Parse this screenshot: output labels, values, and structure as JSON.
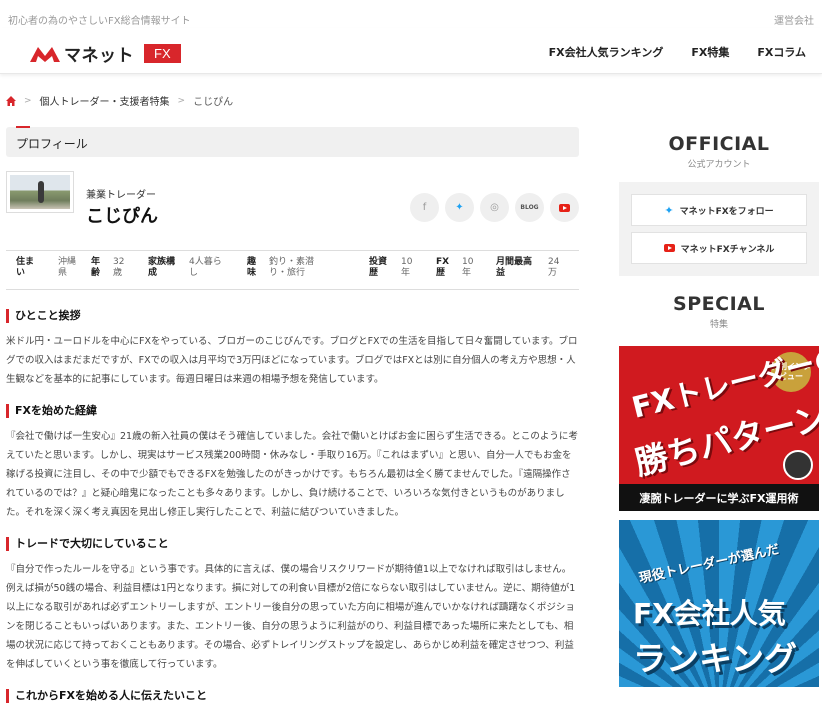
{
  "site": {
    "tagline": "初心者の為のやさしいFX総合情報サイト",
    "operator_link": "運営会社",
    "logo_text": "マネット",
    "logo_badge": "FX",
    "brand_color": "#d8262b"
  },
  "nav": [
    "FX会社人気ランキング",
    "FX特集",
    "FXコラム"
  ],
  "breadcrumb": {
    "home_icon": "home-icon",
    "items": [
      "個人トレーダー・支援者特集",
      "こじぴん"
    ]
  },
  "profile": {
    "section_title": "プロフィール",
    "role": "兼業トレーダー",
    "name": "こじぴん",
    "socials": [
      "facebook-icon",
      "twitter-icon",
      "instagram-icon",
      "BLOG",
      "youtube-icon"
    ],
    "stats": [
      {
        "label": "住まい",
        "value": "沖縄県"
      },
      {
        "label": "年齢",
        "value": "32歳"
      },
      {
        "label": "家族構成",
        "value": "4人暮らし"
      },
      {
        "label": "趣味",
        "value": "釣り・素潜り・旅行"
      },
      {
        "label": "投資歴",
        "value": "10年"
      },
      {
        "label": "FX歴",
        "value": "10年"
      },
      {
        "label": "月間最高益",
        "value": "24万"
      }
    ]
  },
  "sections": [
    {
      "title": "ひとこと挨拶",
      "body": "米ドル円・ユーロドルを中心にFXをやっている、ブロガーのこじぴんです。ブログとFXでの生活を目指して日々奮闘しています。ブログでの収入はまだまだですが、FXでの収入は月平均で3万円ほどになっています。ブログではFXとは別に自分個人の考え方や思想・人生観などを基本的に記事にしています。毎週日曜日は来週の相場予想を発信しています。"
    },
    {
      "title": "FXを始めた経緯",
      "body": "『会社で働けば一生安心』21歳の新入社員の僕はそう確信していました。会社で働いとけばお金に困らず生活できる。とこのように考えていたと思います。しかし、現実はサービス残業200時間・休みなし・手取り16万。『これはまずい』と思い、自分一人でもお金を稼げる投資に注目し、その中で少額でもできるFXを勉強したのがきっかけです。もちろん最初は全く勝てませんでした。『遠隔操作されているのでは？』と疑心暗鬼になったことも多々あります。しかし、負け続けることで、いろいろな気付きというものがありました。それを深く深く考え真因を見出し修正し実行したことで、利益に結びついていきました。"
    },
    {
      "title": "トレードで大切にしていること",
      "body": "『自分で作ったルールを守る』という事です。具体的に言えば、僕の場合リスクリワードが期待値1以上でなければ取引はしません。例えば損が50銭の場合、利益目標は1円となります。損に対しての利食い目標が2倍にならない取引はしていません。逆に、期待値が1以上になる取引があれば必ずエントリーしますが、エントリー後自分の思っていた方向に相場が進んでいかなければ躊躇なくポジションを閉じることもいっぱいあります。また、エントリー後、自分の思うように利益がのり、利益目標であった場所に来たとしても、相場の状況に応じて持っておくこともあります。その場合、必ずトレイリングストップを設定し、あらかじめ利益を確定させつつ、利益を伸ばしていくという事を徹底して行っています。"
    },
    {
      "title": "これからFXを始める人に伝えたいこと",
      "body": ""
    }
  ],
  "sidebar": {
    "official_title": "OFFICIAL",
    "official_sub": "公式アカウント",
    "twitter_btn": "マネットFXをフォロー",
    "youtube_btn": "マネットFXチャンネル",
    "special_title": "SPECIAL",
    "special_sub": "特集",
    "banner1": {
      "line1": "FXトレーダーの",
      "line2": "勝ちパターン",
      "badge": "特別インタビュー",
      "strip": "凄腕トレーダーに学ぶFX運用術"
    },
    "banner2": {
      "line1": "現役トレーダーが選んだ",
      "line2": "FX会社人気",
      "line3": "ランキング"
    }
  }
}
